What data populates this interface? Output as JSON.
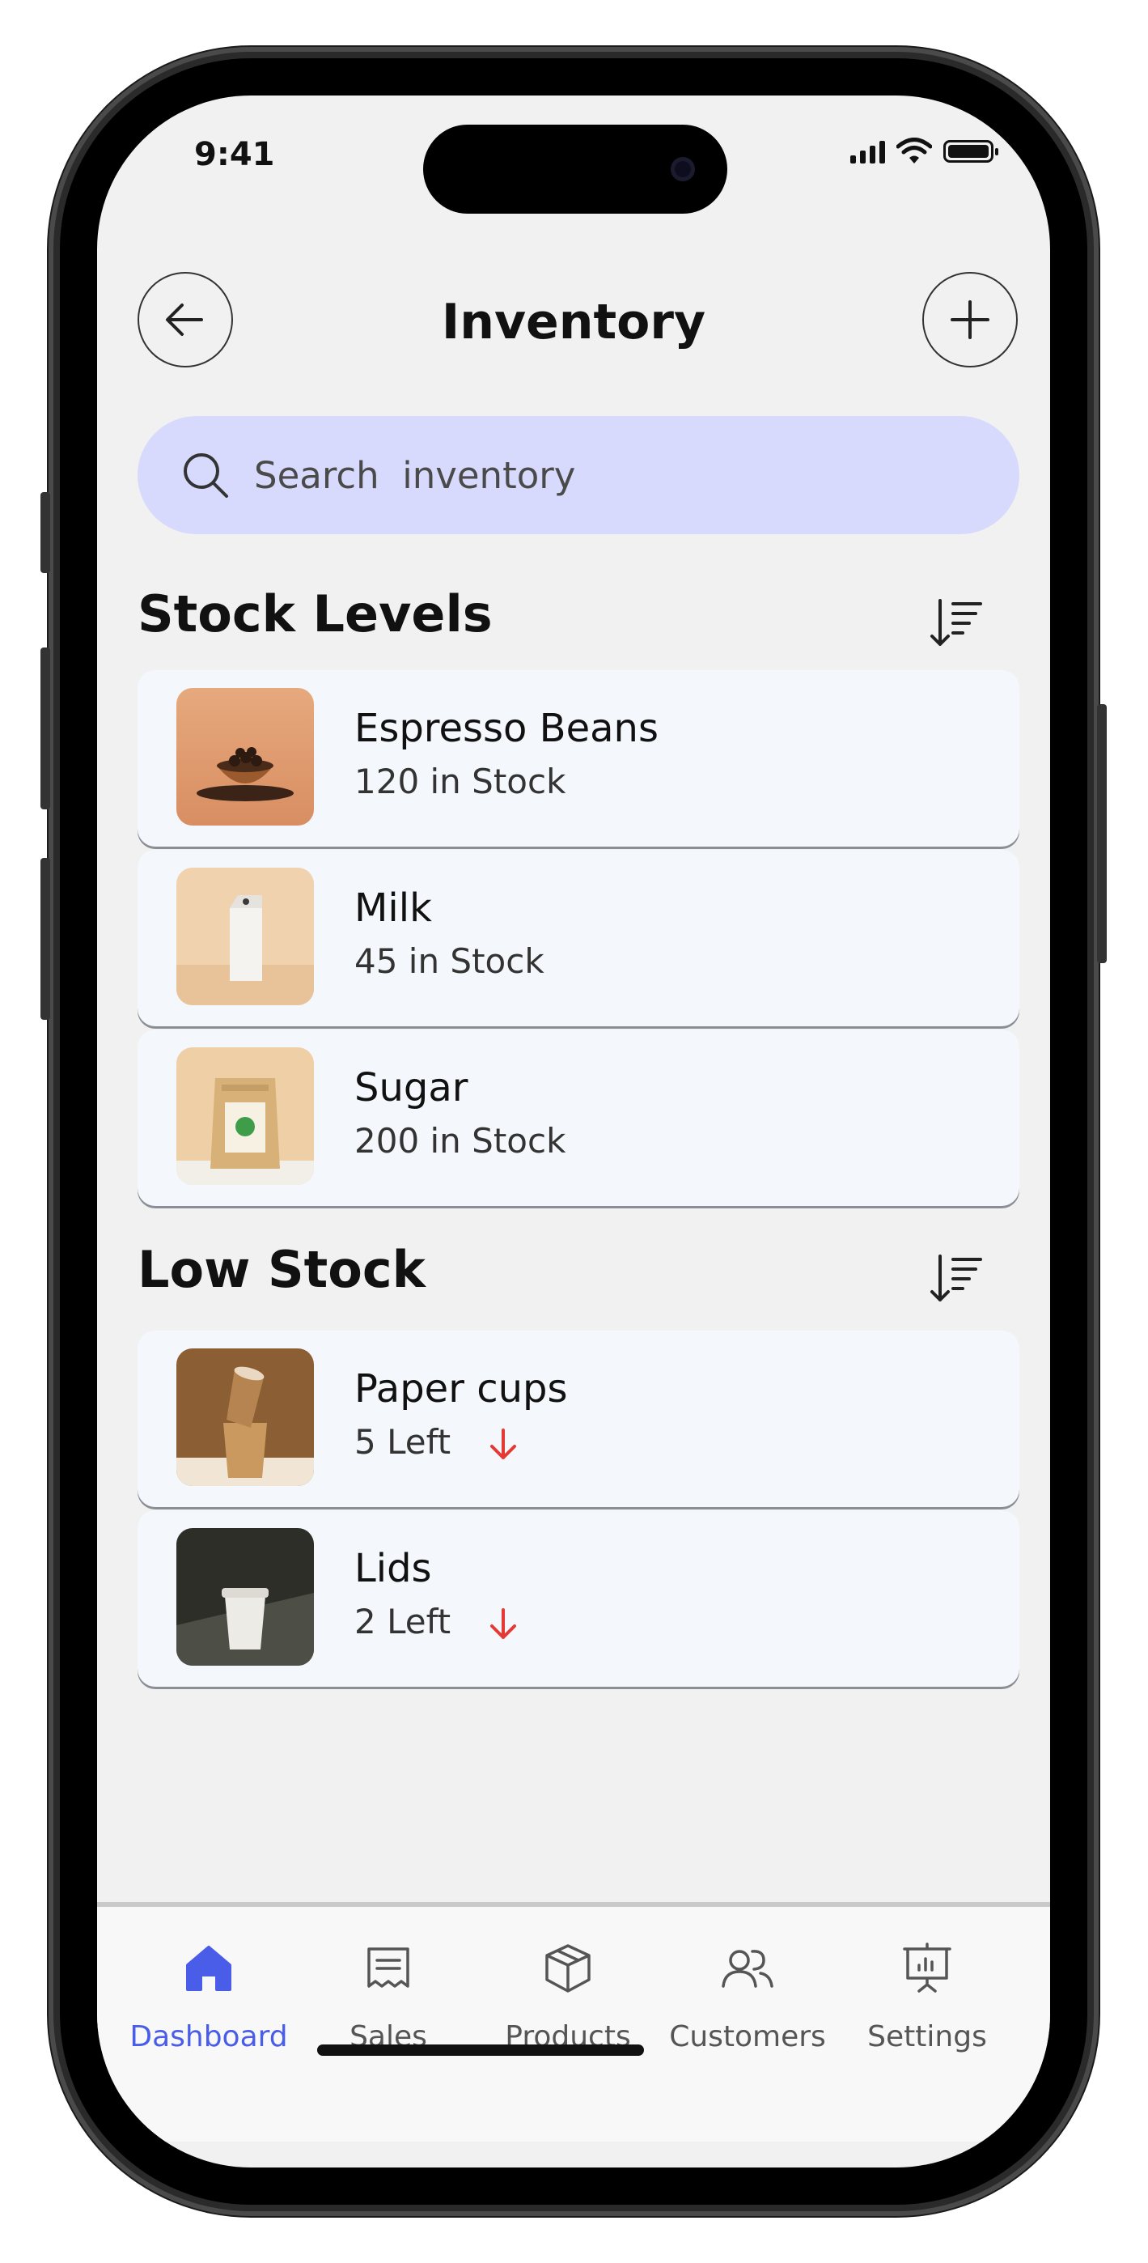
{
  "status_bar": {
    "time": "9:41"
  },
  "header": {
    "title": "Inventory"
  },
  "search": {
    "placeholder": "Search  inventory"
  },
  "stock_levels": {
    "title": "Stock Levels",
    "items": [
      {
        "name": "Espresso Beans",
        "stock": "120 in Stock",
        "thumb": "coffee-beans"
      },
      {
        "name": "Milk",
        "stock": "45 in Stock",
        "thumb": "milk-carton"
      },
      {
        "name": "Sugar",
        "stock": "200 in Stock",
        "thumb": "sugar-pouch"
      }
    ]
  },
  "low_stock": {
    "title": "Low Stock",
    "items": [
      {
        "name": "Paper cups",
        "stock": "5 Left",
        "thumb": "paper-cups"
      },
      {
        "name": "Lids",
        "stock": "2 Left",
        "thumb": "cup-lids"
      }
    ]
  },
  "nav": {
    "items": [
      {
        "label": "Dashboard",
        "icon": "home-icon",
        "active": true
      },
      {
        "label": "Sales",
        "icon": "receipt-icon",
        "active": false
      },
      {
        "label": "Products",
        "icon": "box-icon",
        "active": false
      },
      {
        "label": "Customers",
        "icon": "users-icon",
        "active": false
      },
      {
        "label": "Settings",
        "icon": "presentation-icon",
        "active": false
      }
    ]
  },
  "colors": {
    "accent": "#4a5de8",
    "search_bg": "#d8dafd",
    "alert_red": "#e53935",
    "card_bg": "#f4f7fb",
    "screen_bg": "#f1f1f1"
  }
}
